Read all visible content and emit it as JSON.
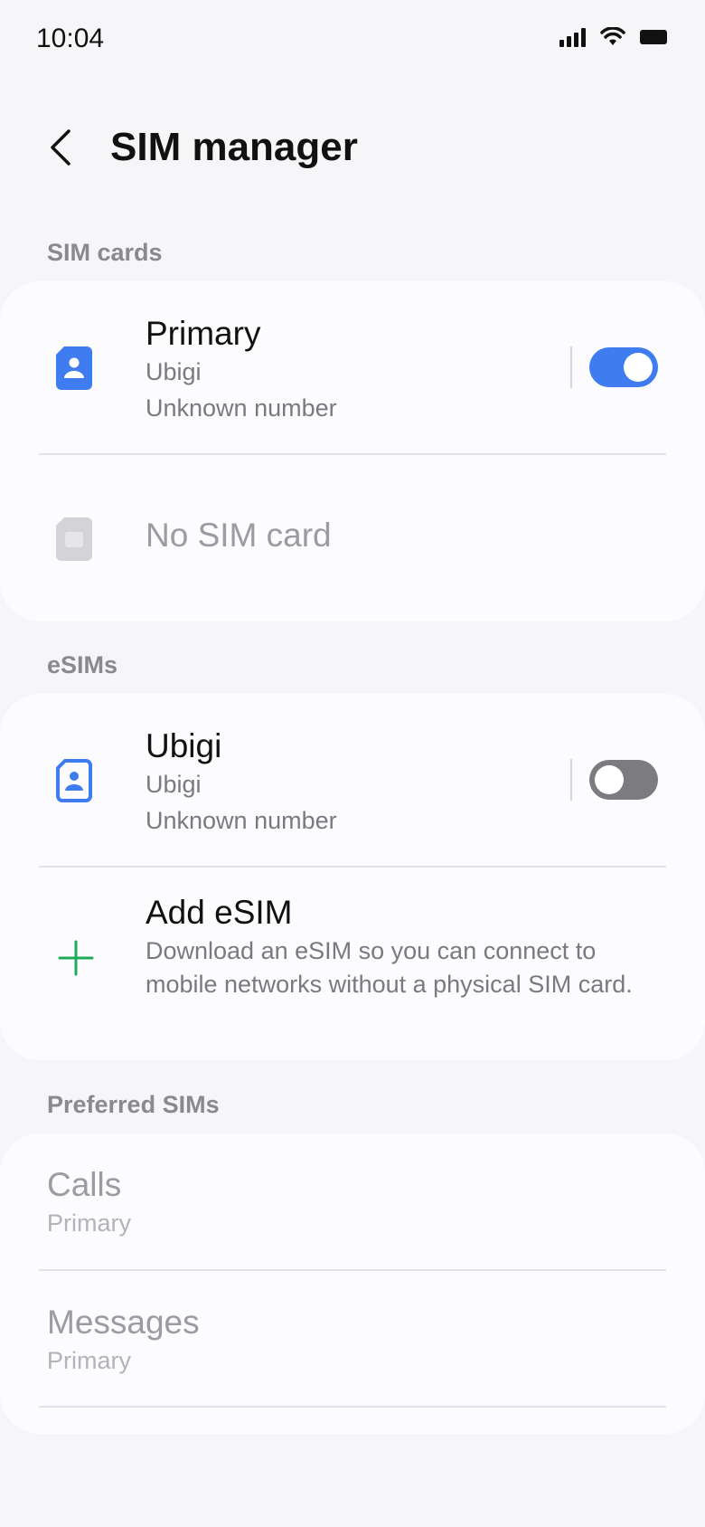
{
  "status": {
    "time": "10:04"
  },
  "header": {
    "title": "SIM manager"
  },
  "sim_cards": {
    "label": "SIM cards",
    "primary": {
      "title": "Primary",
      "carrier": "Ubigi",
      "number": "Unknown number",
      "enabled": true
    },
    "empty": {
      "title": "No SIM card"
    }
  },
  "esims": {
    "label": "eSIMs",
    "ubigi": {
      "title": "Ubigi",
      "carrier": "Ubigi",
      "number": "Unknown number",
      "enabled": false
    },
    "add": {
      "title": "Add eSIM",
      "description": "Download an eSIM so you can connect to mobile networks without a physical SIM card."
    }
  },
  "preferred": {
    "label": "Preferred SIMs",
    "calls": {
      "title": "Calls",
      "value": "Primary"
    },
    "messages": {
      "title": "Messages",
      "value": "Primary"
    }
  },
  "colors": {
    "accent": "#3e7cf0",
    "add_icon": "#1faa59",
    "background": "#f6f6f8",
    "card": "#fcfcfe"
  }
}
